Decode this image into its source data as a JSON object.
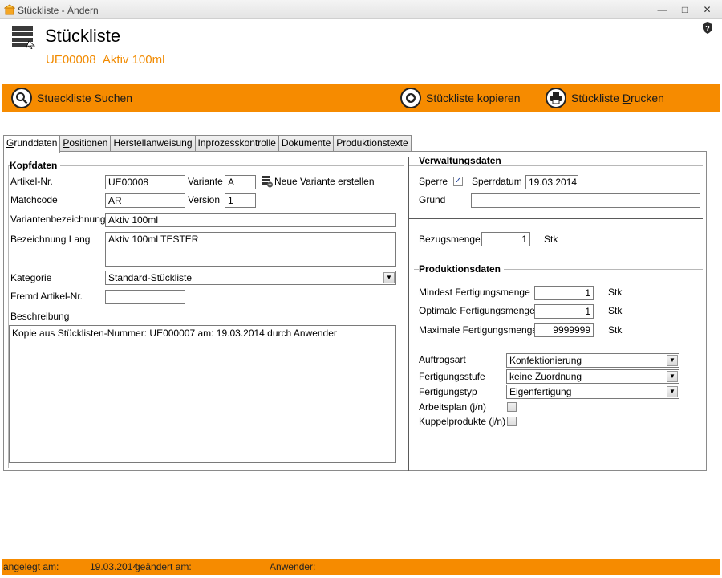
{
  "window": {
    "title": "Stückliste - Ändern",
    "min": "—",
    "max": "□",
    "close": "✕"
  },
  "header": {
    "title": "Stückliste",
    "subtitle_code": "UE00008",
    "subtitle_name": "Aktiv 100ml"
  },
  "toolbar": {
    "search_label": "Stueckliste Suchen",
    "copy_label": "Stückliste kopieren",
    "print_label_pre": "Stückliste ",
    "print_label_underlined": "D",
    "print_label_post": "rucken"
  },
  "tabs": [
    {
      "label_u": "G",
      "label_rest": "runddaten"
    },
    {
      "label_u": "P",
      "label_rest": "ositionen"
    },
    {
      "label_u": "",
      "label_rest": "Herstellanweisung"
    },
    {
      "label_u": "",
      "label_rest": "Inprozesskontrolle"
    },
    {
      "label_u": "",
      "label_rest": "Dokumente"
    },
    {
      "label_u": "",
      "label_rest": "Produktionstexte"
    }
  ],
  "kopfdaten": {
    "section": "Kopfdaten",
    "artikel_label": "Artikel-Nr.",
    "artikel_value": "UE00008",
    "variante_label": "Variante",
    "variante_value": "A",
    "neue_variante": "Neue Variante erstellen",
    "matchcode_label": "Matchcode",
    "matchcode_value": "AR",
    "version_label": "Version",
    "version_value": "1",
    "variantenbez_label": "Variantenbezeichnung",
    "variantenbez_value": "Aktiv 100ml",
    "bez_lang_label": "Bezeichnung Lang",
    "bez_lang_value": "Aktiv 100ml TESTER",
    "kategorie_label": "Kategorie",
    "kategorie_value": "Standard-Stückliste",
    "fremd_label": "Fremd Artikel-Nr.",
    "fremd_value": "",
    "beschreibung_label": "Beschreibung",
    "beschreibung_value": "Kopie aus Stücklisten-Nummer: UE000007 am: 19.03.2014 durch Anwender"
  },
  "verwaltung": {
    "section": "Verwaltungsdaten",
    "sperre_label": "Sperre",
    "sperre_checked": true,
    "sperrdatum_label": "Sperrdatum",
    "sperrdatum_value": "19.03.2014",
    "grund_label": "Grund",
    "grund_value": "",
    "bezugsmenge_label": "Bezugsmenge",
    "bezugsmenge_value": "1",
    "bezugsmenge_unit": "Stk"
  },
  "produktion": {
    "section": "Produktionsdaten",
    "mindest_label": "Mindest Fertigungsmenge",
    "mindest_value": "1",
    "optimal_label": "Optimale Fertigungsmenge",
    "optimal_value": "1",
    "maximal_label": "Maximale Fertigungsmenge",
    "maximal_value": "9999999",
    "unit": "Stk",
    "auftragsart_label": "Auftragsart",
    "auftragsart_value": "Konfektionierung",
    "stufe_label": "Fertigungsstufe",
    "stufe_value": "keine Zuordnung",
    "typ_label": "Fertigungstyp",
    "typ_value": "Eigenfertigung",
    "arbeitsplan_label": "Arbeitsplan (j/n)",
    "kuppel_label": "Kuppelprodukte (j/n)"
  },
  "status": {
    "angelegt_label": "angelegt am:",
    "angelegt_value": "19.03.2014",
    "geaendert_label": "geändert am:",
    "anwender_label": "Anwender:"
  },
  "colors": {
    "accent": "#f68b00",
    "subtitle": "#f18a00"
  }
}
